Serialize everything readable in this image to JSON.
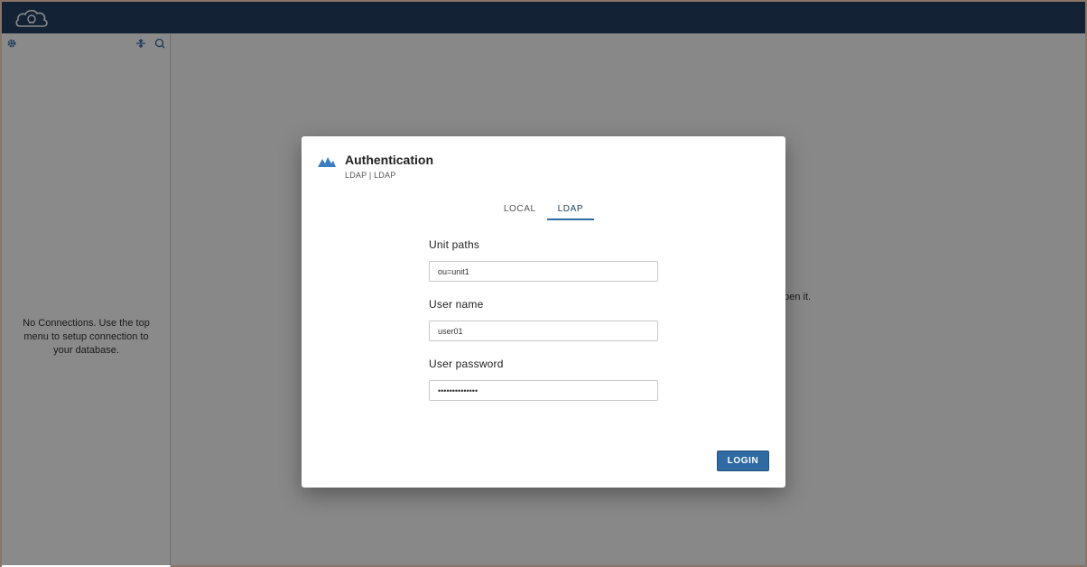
{
  "colors": {
    "topbar": "#234262",
    "accent": "#2f6aa3"
  },
  "topbar": {
    "logo_icon": "database-cloud-logo-icon"
  },
  "sidebar": {
    "tools": {
      "settings_icon": "gear-icon",
      "collapse_icon": "collapse-icon",
      "refresh_icon": "search-icon"
    },
    "empty_message": "No Connections. Use the top menu to setup connection to your database."
  },
  "main": {
    "hint_fragment": "open it."
  },
  "dialog": {
    "title": "Authentication",
    "subtitle": "LDAP | LDAP",
    "tabs": [
      {
        "label": "LOCAL",
        "active": false
      },
      {
        "label": "LDAP",
        "active": true
      }
    ],
    "fields": {
      "unit_paths": {
        "label": "Unit paths",
        "value": "ou=unit1"
      },
      "user_name": {
        "label": "User name",
        "value": "user01"
      },
      "user_password": {
        "label": "User password",
        "value": "••••••••••••••"
      }
    },
    "login_label": "LOGIN"
  }
}
